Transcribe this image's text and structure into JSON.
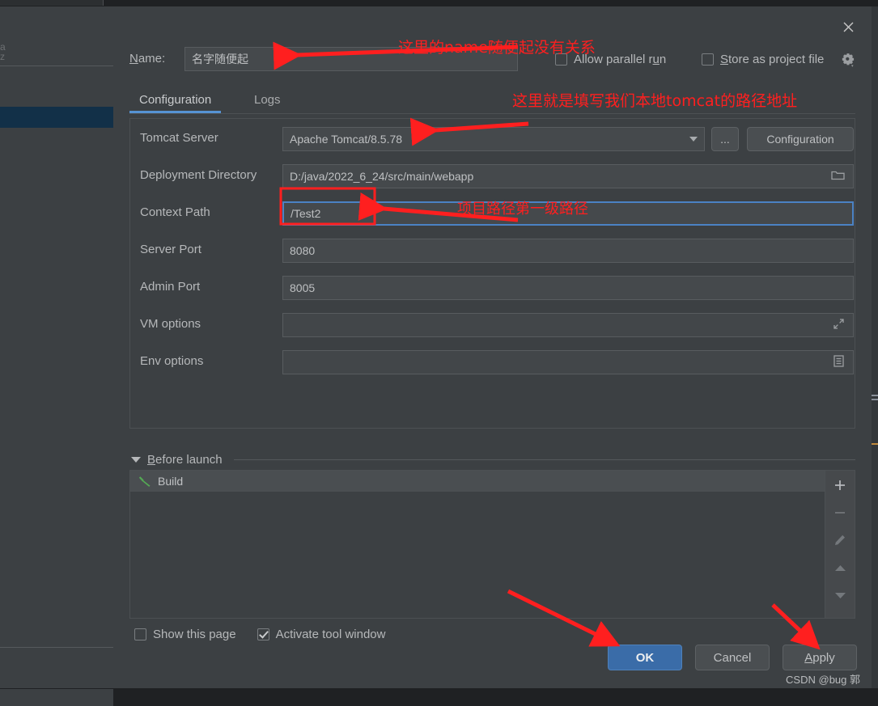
{
  "dialog": {
    "close_icon": "close-icon",
    "name_label": "Name:",
    "name_value": "名字随便起",
    "allow_parallel_run": "Allow parallel run",
    "store_as_project_file": "Store as project file",
    "gear_icon": "gear-icon",
    "tabs": [
      {
        "label": "Configuration",
        "active": true
      },
      {
        "label": "Logs",
        "active": false
      }
    ],
    "fields": [
      {
        "label": "Tomcat Server",
        "value": "Apache Tomcat/8.5.78",
        "kind": "combo"
      },
      {
        "label": "Deployment Directory",
        "value": "D:/java/2022_6_24/src/main/webapp",
        "kind": "folder"
      },
      {
        "label": "Context Path",
        "value": "/Test2",
        "kind": "text"
      },
      {
        "label": "Server Port",
        "value": "8080",
        "kind": "text"
      },
      {
        "label": "Admin Port",
        "value": "8005",
        "kind": "text"
      },
      {
        "label": "VM options",
        "value": "",
        "kind": "expand"
      },
      {
        "label": "Env options",
        "value": "",
        "kind": "list"
      }
    ],
    "ellipsis_button": "...",
    "configuration_button": "Configuration",
    "before_launch": {
      "title": "Before launch",
      "items": [
        {
          "label": "Build",
          "icon": "hammer-icon"
        }
      ],
      "toolbar": [
        {
          "name": "add-button",
          "glyph": "+"
        },
        {
          "name": "remove-button",
          "glyph": "−"
        },
        {
          "name": "edit-button",
          "glyph": "✎"
        },
        {
          "name": "move-up-button",
          "glyph": "▲"
        },
        {
          "name": "move-down-button",
          "glyph": "▼"
        }
      ]
    },
    "show_this_page": "Show this page",
    "activate_tool_window": "Activate tool window",
    "buttons": {
      "ok": "OK",
      "cancel": "Cancel",
      "apply": "Apply"
    }
  },
  "annotations": [
    {
      "text": "这里的name随便起没有关系",
      "name": "annotation-name-note"
    },
    {
      "text": "这里就是填写我们本地tomcat的路径地址",
      "name": "annotation-tomcat-note"
    },
    {
      "text": "项目路径第一级路径",
      "name": "annotation-context-path-note"
    }
  ],
  "watermark": "CSDN @bug 郭",
  "colors": {
    "accent_blue": "#4b82c4",
    "annotation_red": "#ff1f1f",
    "panel_bg": "#3c4043",
    "primary_button": "#3a6ca8",
    "selection_blue": "#123048",
    "hammer_green": "#54a954"
  }
}
